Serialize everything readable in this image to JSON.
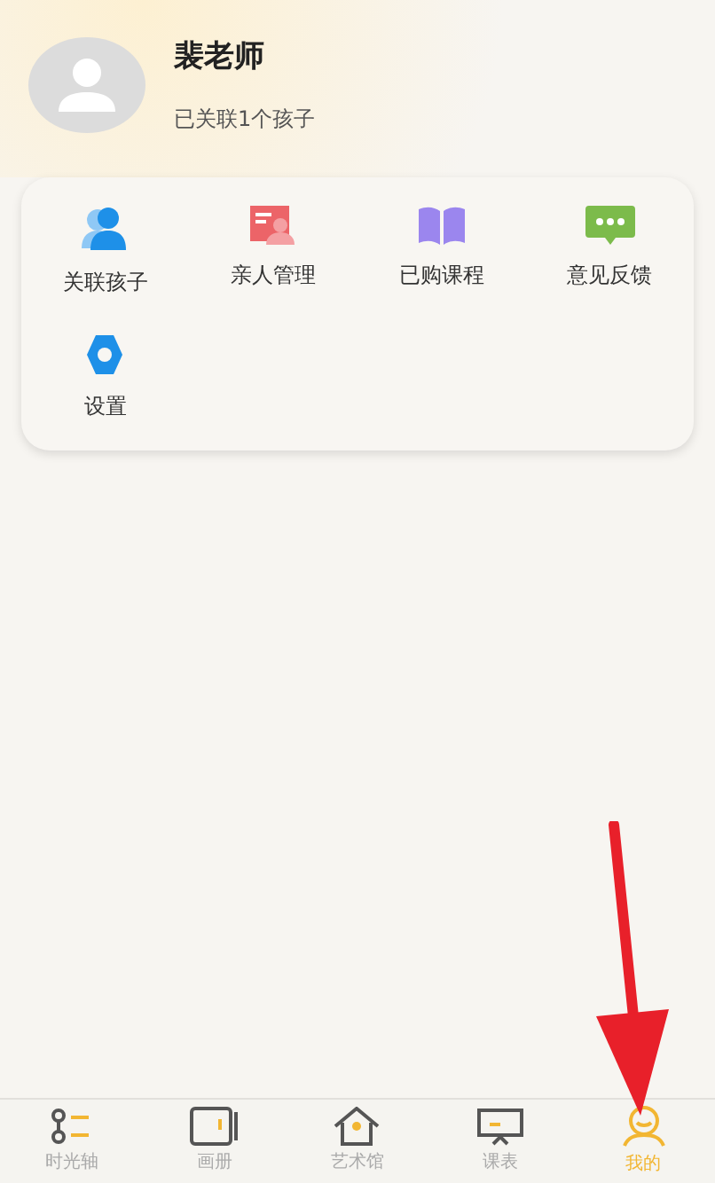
{
  "profile": {
    "name": "裴老师",
    "subtitle": "已关联1个孩子"
  },
  "menu": [
    {
      "kind": "children",
      "label": "关联孩子"
    },
    {
      "kind": "family",
      "label": "亲人管理"
    },
    {
      "kind": "courses",
      "label": "已购课程"
    },
    {
      "kind": "feedback",
      "label": "意见反馈"
    },
    {
      "kind": "settings",
      "label": "设置"
    }
  ],
  "tabs": [
    {
      "kind": "timeline",
      "label": "时光轴",
      "selected": false
    },
    {
      "kind": "album",
      "label": "画册",
      "selected": false
    },
    {
      "kind": "gallery",
      "label": "艺术馆",
      "selected": false
    },
    {
      "kind": "schedule",
      "label": "课表",
      "selected": false
    },
    {
      "kind": "me",
      "label": "我的",
      "selected": true
    }
  ]
}
